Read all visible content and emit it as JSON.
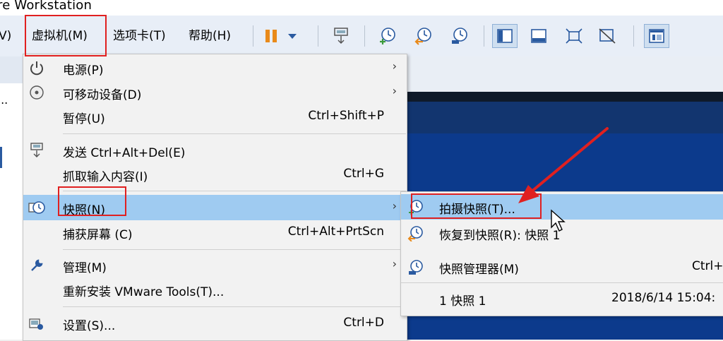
{
  "window": {
    "title": "re Workstation"
  },
  "menubar": {
    "items": [
      {
        "label": "V)"
      },
      {
        "label": "虚拟机(M)"
      },
      {
        "label": "选项卡(T)"
      },
      {
        "label": "帮助(H)"
      }
    ]
  },
  "toolbar": {
    "icons": [
      "pause-icon",
      "dropdown-icon",
      "send-ctrl-alt-del-icon",
      "take-snapshot-icon",
      "revert-snapshot-icon",
      "snapshot-manager-icon",
      "console-view-icon",
      "thumbnail-view-icon",
      "fullscreen-icon",
      "unity-icon",
      "library-icon"
    ]
  },
  "left_pane": {
    "text": "..."
  },
  "vm_menu": {
    "items": [
      {
        "label": "电源(P)",
        "shortcut": "",
        "submenu": true,
        "icon": "power-icon"
      },
      {
        "label": "可移动设备(D)",
        "shortcut": "",
        "submenu": true,
        "icon": "cd-icon"
      },
      {
        "label": "暂停(U)",
        "shortcut": "Ctrl+Shift+P",
        "submenu": false,
        "icon": ""
      },
      {
        "label": "发送 Ctrl+Alt+Del(E)",
        "shortcut": "",
        "submenu": false,
        "icon": "send-keys-icon"
      },
      {
        "label": "抓取输入内容(I)",
        "shortcut": "Ctrl+G",
        "submenu": false,
        "icon": ""
      },
      {
        "label": "快照(N)",
        "shortcut": "",
        "submenu": true,
        "icon": "snapshot-icon",
        "highlighted": true
      },
      {
        "label": "捕获屏幕 (C)",
        "shortcut": "Ctrl+Alt+PrtScn",
        "submenu": false,
        "icon": ""
      },
      {
        "label": "管理(M)",
        "shortcut": "",
        "submenu": true,
        "icon": "wrench-icon"
      },
      {
        "label": "重新安装 VMware Tools(T)...",
        "shortcut": "",
        "submenu": false,
        "icon": ""
      },
      {
        "label": "设置(S)...",
        "shortcut": "Ctrl+D",
        "submenu": false,
        "icon": "settings-icon"
      }
    ],
    "arrow": "›"
  },
  "snapshot_menu": {
    "items": [
      {
        "label": "拍摄快照(T)...",
        "shortcut": "",
        "icon": "take-snapshot-icon",
        "highlighted": true
      },
      {
        "label": "恢复到快照(R): 快照 1",
        "shortcut": "",
        "icon": "revert-snapshot-icon"
      },
      {
        "label": "快照管理器(M)",
        "shortcut": "Ctrl+",
        "icon": "snapshot-manager-icon"
      },
      {
        "label": "1   快照 1",
        "shortcut": "2018/6/14 15:04:",
        "icon": ""
      }
    ]
  },
  "colors": {
    "highlight": "#9fcbf1",
    "annotation_red": "#e02020",
    "vm_blue": "#0c3a8c"
  }
}
